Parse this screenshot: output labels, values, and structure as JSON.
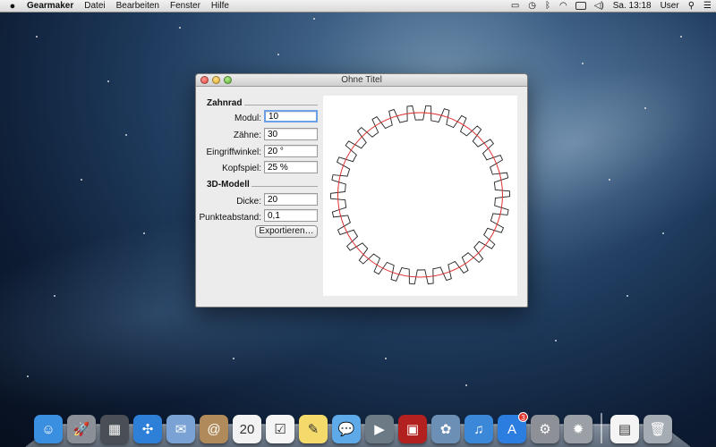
{
  "menubar": {
    "app_name": "Gearmaker",
    "menus": [
      "Datei",
      "Bearbeiten",
      "Fenster",
      "Hilfe"
    ],
    "clock": "Sa. 13:18",
    "user": "User",
    "icons": [
      "apple-icon",
      "wifi-icon",
      "bluetooth-icon",
      "time-machine-icon",
      "battery-icon",
      "spotlight-icon",
      "notification-center-icon"
    ]
  },
  "window": {
    "title": "Ohne Titel",
    "sections": {
      "gear": "Zahnrad",
      "model": "3D-Modell"
    },
    "fields": {
      "modul": {
        "label": "Modul:",
        "value": "10"
      },
      "zaehne": {
        "label": "Zähne:",
        "value": "30"
      },
      "eingriffwinkel": {
        "label": "Eingriffwinkel:",
        "value": "20 °"
      },
      "kopfspiel": {
        "label": "Kopfspiel:",
        "value": "25 %"
      },
      "dicke": {
        "label": "Dicke:",
        "value": "20"
      },
      "punkteabstand": {
        "label": "Punkteabstand:",
        "value": "0,1"
      }
    },
    "export_label": "Exportieren…",
    "gear_preview": {
      "teeth": 30,
      "pitch_color": "#e03030",
      "outline_color": "#222222"
    }
  },
  "dock": {
    "items": [
      {
        "name": "finder-icon",
        "color": "#3b8fe0",
        "glyph": "☺"
      },
      {
        "name": "launchpad-icon",
        "color": "#8a8f98",
        "glyph": "🚀"
      },
      {
        "name": "mission-control-icon",
        "color": "#4a4f55",
        "glyph": "▦"
      },
      {
        "name": "safari-icon",
        "color": "#2e7fd8",
        "glyph": "✣"
      },
      {
        "name": "mail-icon",
        "color": "#7aa2d4",
        "glyph": "✉"
      },
      {
        "name": "contacts-icon",
        "color": "#b08a5a",
        "glyph": "@"
      },
      {
        "name": "calendar-icon",
        "color": "#f2f2f2",
        "glyph": "20"
      },
      {
        "name": "reminders-icon",
        "color": "#f5f5f5",
        "glyph": "☑"
      },
      {
        "name": "notes-icon",
        "color": "#f4d96b",
        "glyph": "✎"
      },
      {
        "name": "messages-icon",
        "color": "#5ea9e8",
        "glyph": "💬"
      },
      {
        "name": "facetime-icon",
        "color": "#6c7a86",
        "glyph": "▶"
      },
      {
        "name": "photo-booth-icon",
        "color": "#b32020",
        "glyph": "▣"
      },
      {
        "name": "iphoto-icon",
        "color": "#6b8fb5",
        "glyph": "✿"
      },
      {
        "name": "itunes-icon",
        "color": "#3b87d8",
        "glyph": "♫"
      },
      {
        "name": "app-store-icon",
        "color": "#2b7de0",
        "glyph": "A",
        "badge": "3"
      },
      {
        "name": "system-preferences-icon",
        "color": "#8d9096",
        "glyph": "⚙"
      },
      {
        "name": "gearmaker-icon",
        "color": "#9aa0a6",
        "glyph": "✹"
      }
    ],
    "right_items": [
      {
        "name": "documents-icon",
        "color": "#f4f4f4",
        "glyph": "▤"
      },
      {
        "name": "trash-icon",
        "color": "#a6acb3",
        "glyph": "🗑"
      }
    ]
  }
}
